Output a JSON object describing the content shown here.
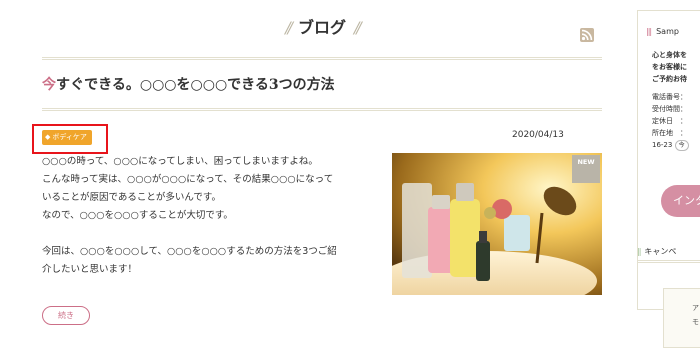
{
  "heading": {
    "left_deco": "//",
    "title": "ブログ",
    "right_deco": "//"
  },
  "icons": {
    "rss": "rss-icon",
    "tag": "tag-icon"
  },
  "colors": {
    "accent_pink": "#cc6f87",
    "tag_orange": "#f0a52b",
    "highlight_red": "#e8141b",
    "rule": "#e3e0cf"
  },
  "post": {
    "title_first": "今",
    "title_rest": "すぐできる。○○○を○○○できる3つの方法",
    "category": "ボディケア",
    "date": "2020/04/13",
    "excerpt_lines": [
      "○○○の時って、○○○になってしまい、困ってしまいますよね。",
      "こんな時って実は、○○○が○○○になって、その結果○○○になって",
      "いることが原因であることが多いんです。",
      "なので、○○○を○○○することが大切です。",
      "",
      "今回は、○○○を○○○して、○○○を○○○するための方法を3つご紹",
      "介したいと思います！"
    ],
    "thumb_badge": "NEW",
    "more_label": "続き"
  },
  "sidebar": {
    "shop": {
      "title_deco": "|||",
      "title": "Samp",
      "text_lines": [
        "心と身体を",
        "をお客様に",
        "ご予約お待"
      ],
      "info_lines": [
        "電話番号：",
        "受付時間：",
        "定休日　：",
        "所在地　："
      ],
      "hours": "16-23",
      "hours_chip": "今",
      "insta_label": "インタ"
    },
    "campaign": {
      "title_deco": "||",
      "title": "キャンペ",
      "card_lines": [
        "ア",
        "モ"
      ]
    }
  }
}
